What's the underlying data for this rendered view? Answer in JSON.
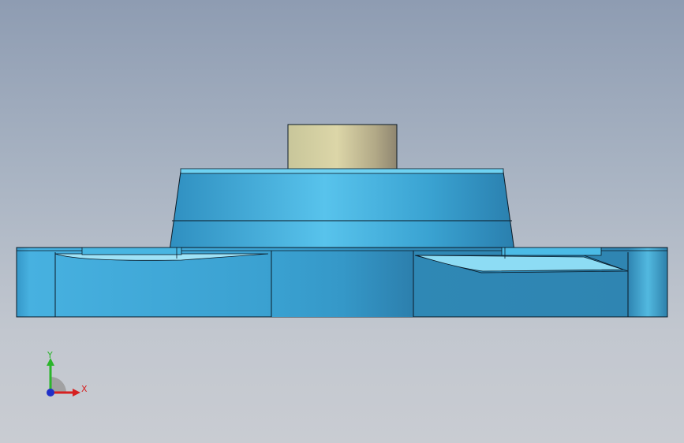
{
  "viewport": {
    "background_top": "#8e9cb2",
    "background_bottom": "#c9ccd2"
  },
  "model": {
    "body_color": "#3a9fd0",
    "body_highlight": "#5cc6ea",
    "shaft_color": "#c9c49a",
    "edge_color": "#0b1a26"
  },
  "triad": {
    "x_label": "X",
    "y_label": "Y",
    "x_color": "#d62020",
    "y_color": "#2bb52b",
    "z_color": "#2030c8"
  }
}
